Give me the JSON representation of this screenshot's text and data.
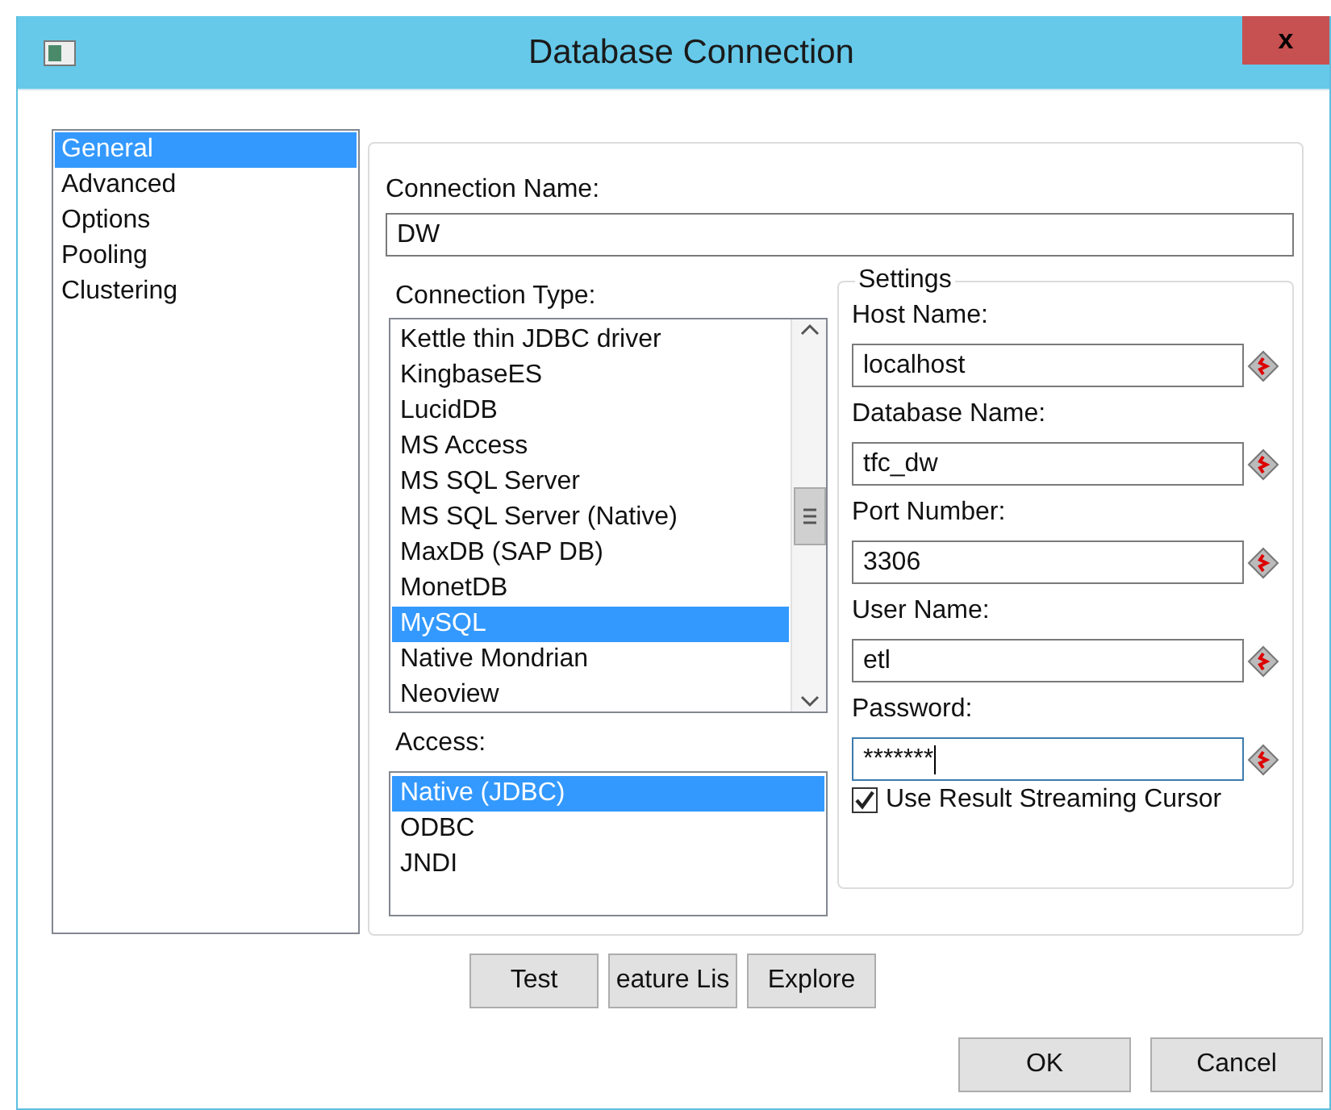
{
  "window": {
    "title": "Database Connection",
    "close": "x"
  },
  "sidebar": {
    "items": [
      {
        "label": "General",
        "selected": true
      },
      {
        "label": "Advanced",
        "selected": false
      },
      {
        "label": "Options",
        "selected": false
      },
      {
        "label": "Pooling",
        "selected": false
      },
      {
        "label": "Clustering",
        "selected": false
      }
    ]
  },
  "connection_name": {
    "label": "Connection Name:",
    "value": "DW"
  },
  "connection_type": {
    "label": "Connection Type:",
    "items": [
      {
        "label": "Kettle thin JDBC driver",
        "selected": false
      },
      {
        "label": "KingbaseES",
        "selected": false
      },
      {
        "label": "LucidDB",
        "selected": false
      },
      {
        "label": "MS Access",
        "selected": false
      },
      {
        "label": "MS SQL Server",
        "selected": false
      },
      {
        "label": "MS SQL Server (Native)",
        "selected": false
      },
      {
        "label": "MaxDB (SAP DB)",
        "selected": false
      },
      {
        "label": "MonetDB",
        "selected": false
      },
      {
        "label": "MySQL",
        "selected": true
      },
      {
        "label": "Native Mondrian",
        "selected": false
      },
      {
        "label": "Neoview",
        "selected": false
      }
    ]
  },
  "access": {
    "label": "Access:",
    "items": [
      {
        "label": "Native (JDBC)",
        "selected": true
      },
      {
        "label": "ODBC",
        "selected": false
      },
      {
        "label": "JNDI",
        "selected": false
      }
    ]
  },
  "settings": {
    "title": "Settings",
    "fields": [
      {
        "label": "Host Name:",
        "value": "localhost",
        "focused": false
      },
      {
        "label": "Database Name:",
        "value": "tfc_dw",
        "focused": false
      },
      {
        "label": "Port Number:",
        "value": "3306",
        "focused": false
      },
      {
        "label": "User Name:",
        "value": "etl",
        "focused": false
      },
      {
        "label": "Password:",
        "value": "*******",
        "focused": true
      }
    ],
    "streaming_cursor": {
      "label": "Use Result Streaming Cursor",
      "checked": true
    }
  },
  "actions": [
    "Test",
    "eature Lis",
    "Explore"
  ],
  "buttons": [
    "OK",
    "Cancel"
  ]
}
